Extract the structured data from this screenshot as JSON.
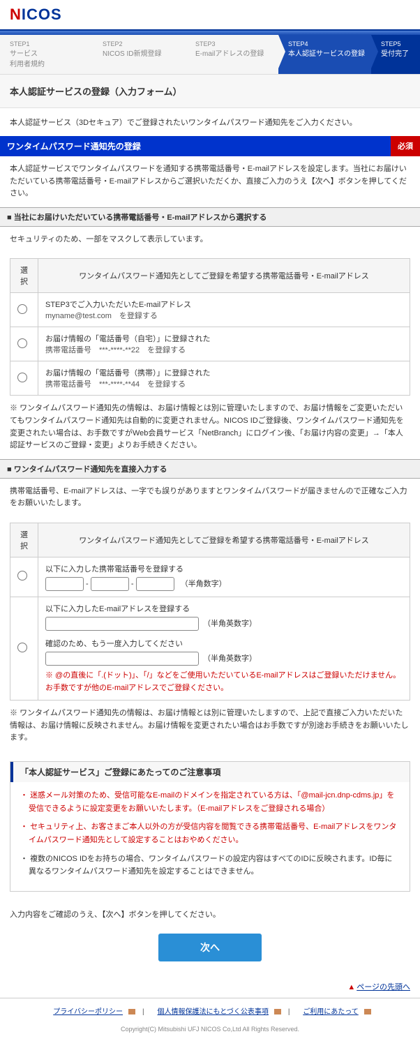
{
  "logo": {
    "n": "N",
    "rest": "ICOS"
  },
  "steps": [
    {
      "num": "STEP1",
      "label": "サービス\n利用者規約"
    },
    {
      "num": "STEP2",
      "label": "NICOS ID新規登録"
    },
    {
      "num": "STEP3",
      "label": "E-mailアドレスの登録"
    },
    {
      "num": "STEP4",
      "label": "本人認証サービスの登録"
    },
    {
      "num": "STEP5",
      "label": "受付完了"
    }
  ],
  "page_title": "本人認証サービスの登録（入力フォーム）",
  "intro": "本人認証サービス（3Dセキュア）でご登録されたいワンタイムパスワード通知先をご入力ください。",
  "section1": {
    "title": "ワンタイムパスワード通知先の登録",
    "required": "必須",
    "desc": "本人認証サービスでワンタイムパスワードを通知する携帯電話番号・E-mailアドレスを設定します。当社にお届けいただいている携帯電話番号・E-mailアドレスからご選択いただくか、直接ご入力のうえ【次へ】ボタンを押してください。"
  },
  "sub1": {
    "title": "当社にお届けいただいている携帯電話番号・E-mailアドレスから選択する",
    "lead": "セキュリティのため、一部をマスクして表示しています。",
    "col_select": "選択",
    "col_desc": "ワンタイムパスワード通知先としてご登録を希望する携帯電話番号・E-mailアドレス",
    "rows": [
      {
        "line1": "STEP3でご入力いただいたE-mailアドレス",
        "line2": "myname@test.com　を登録する"
      },
      {
        "line1": "お届け情報の「電話番号（自宅）」に登録された",
        "line2": "携帯電話番号　***-****-**22　を登録する"
      },
      {
        "line1": "お届け情報の「電話番号（携帯）」に登録された",
        "line2": "携帯電話番号　***-****-**44　を登録する"
      }
    ],
    "note": "ワンタイムパスワード通知先の情報は、お届け情報とは別に管理いたしますので、お届け情報をご変更いただいてもワンタイムパスワード通知先は自動的に変更されません。NICOS IDご登録後、ワンタイムパスワード通知先を変更されたい場合は、お手数ですがWeb会員サービス「NetBranch」にログイン後、「お届け内容の変更」→「本人認証サービスのご登録・変更」よりお手続きください。"
  },
  "sub2": {
    "title": "ワンタイムパスワード通知先を直接入力する",
    "lead": "携帯電話番号、E-mailアドレスは、一字でも誤りがありますとワンタイムパスワードが届きませんので正確なご入力をお願いいたします。",
    "col_select": "選択",
    "col_desc": "ワンタイムパスワード通知先としてご登録を希望する携帯電話番号・E-mailアドレス",
    "row_phone": "以下に入力した携帯電話番号を登録する",
    "row_email": "以下に入力したE-mailアドレスを登録する",
    "row_email_confirm": "確認のため、もう一度入力してください",
    "hint_digits": "（半角数字）",
    "hint_alnum": "（半角英数字）",
    "email_warn": "※ @の直後に「.(ドット)」、「/」などをご使用いただいているE-mailアドレスはご登録いただけません。お手数ですが他のE-mailアドレスでご登録ください。",
    "note": "ワンタイムパスワード通知先の情報は、お届け情報とは別に管理いたしますので、上記で直接ご入力いただいた情報は、お届け情報に反映されません。お届け情報を変更されたい場合はお手数ですが別途お手続きをお願いいたします。"
  },
  "caution": {
    "title": "「本人認証サービス」ご登録にあたってのご注意事項",
    "items": [
      {
        "red": true,
        "text": "迷惑メール対策のため、受信可能なE-mailのドメインを指定されている方は、「@mail-jcn.dnp-cdms.jp」を受信できるように設定変更をお願いいたします。（E-mailアドレスをご登録される場合）"
      },
      {
        "red": true,
        "text": "セキュリティ上、お客さまご本人以外の方が受信内容を閲覧できる携帯電話番号、E-mailアドレスをワンタイムパスワード通知先として設定することはおやめください。"
      },
      {
        "red": false,
        "text": "複数のNICOS IDをお持ちの場合、ワンタイムパスワードの設定内容はすべてのIDに反映されます。ID毎に異なるワンタイムパスワード通知先を設定することはできません。"
      }
    ]
  },
  "confirm_text": "入力内容をご確認のうえ、【次へ】ボタンを押してください。",
  "next_button": "次へ",
  "pagetop": "ページの先頭へ",
  "footer": {
    "links": [
      "プライバシーポリシー",
      "個人情報保護法にもとづく公表事項",
      "ご利用にあたって"
    ],
    "copyright": "Copyright(C) Mitsubishi UFJ NICOS Co,Ltd All Rights Reserved."
  }
}
